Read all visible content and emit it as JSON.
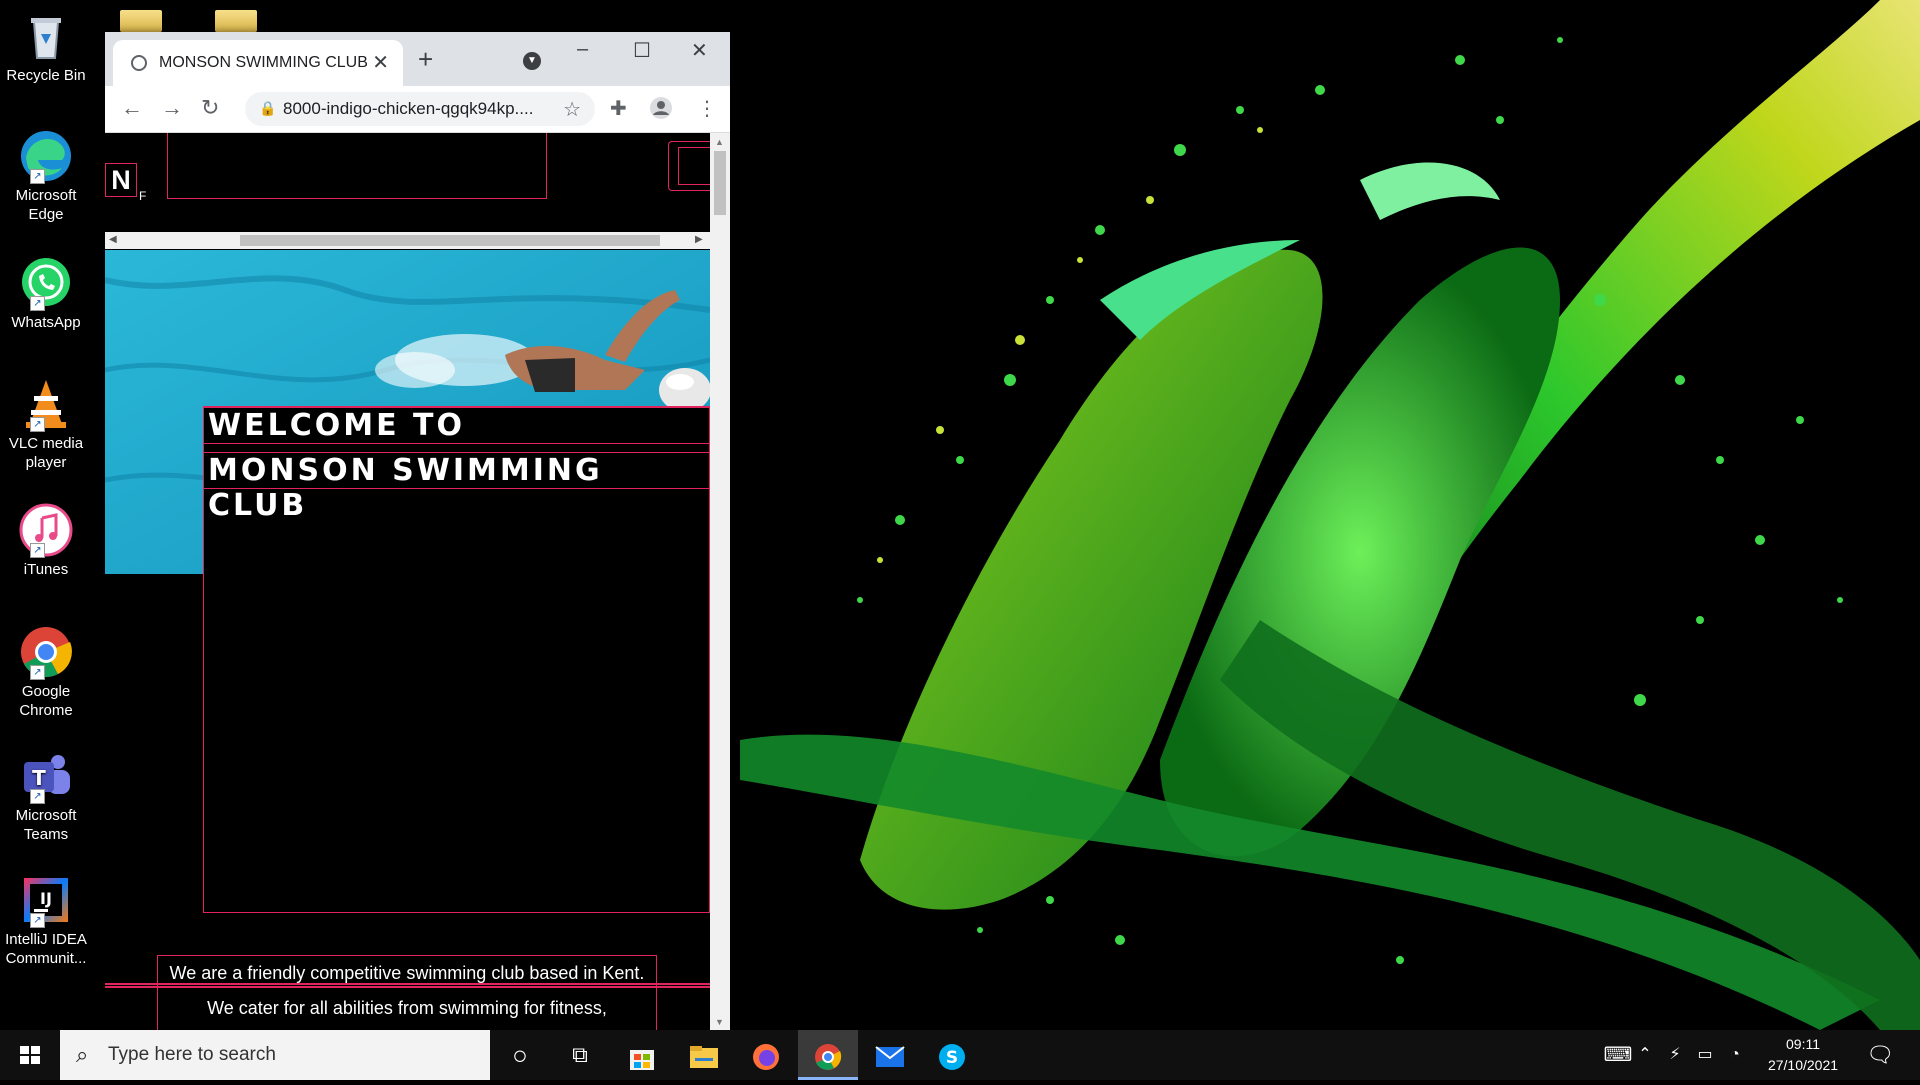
{
  "desktop": {
    "icons": [
      {
        "label": "Recycle Bin",
        "icon": "recycle-bin-icon"
      },
      {
        "label": "Microsoft Edge",
        "icon": "edge-icon"
      },
      {
        "label": "WhatsApp",
        "icon": "whatsapp-icon"
      },
      {
        "label": "VLC media player",
        "icon": "vlc-icon"
      },
      {
        "label": "iTunes",
        "icon": "itunes-icon"
      },
      {
        "label": "Google Chrome",
        "icon": "chrome-icon"
      },
      {
        "label": "Microsoft Teams",
        "icon": "teams-icon"
      },
      {
        "label": "IntelliJ IDEA Communit...",
        "icon": "intellij-icon"
      }
    ]
  },
  "browser": {
    "tab_title": "MONSON SWIMMING CLUB",
    "tab_close": "✕",
    "new_tab": "+",
    "url": "8000-indigo-chicken-qgqk94kp....",
    "window_controls": {
      "minimize": "–",
      "maximize": "☐",
      "close": "✕"
    }
  },
  "page": {
    "nav_logo": "N",
    "nav_partial": "F",
    "heading_line1": "WELCOME TO",
    "heading_line2": "MONSON SWIMMING CLUB",
    "about_text": "We are a friendly competitive swimming club based in Kent. We cater for all abilities from swimming for fitness,"
  },
  "taskbar": {
    "search_placeholder": "Type here to search",
    "time": "09:11",
    "date": "27/10/2021"
  },
  "colors": {
    "accent_pink": "#e0245e",
    "pool_blue": "#1fa9c9",
    "splash_green": "#22c53a",
    "splash_yellow": "#d8e022"
  }
}
